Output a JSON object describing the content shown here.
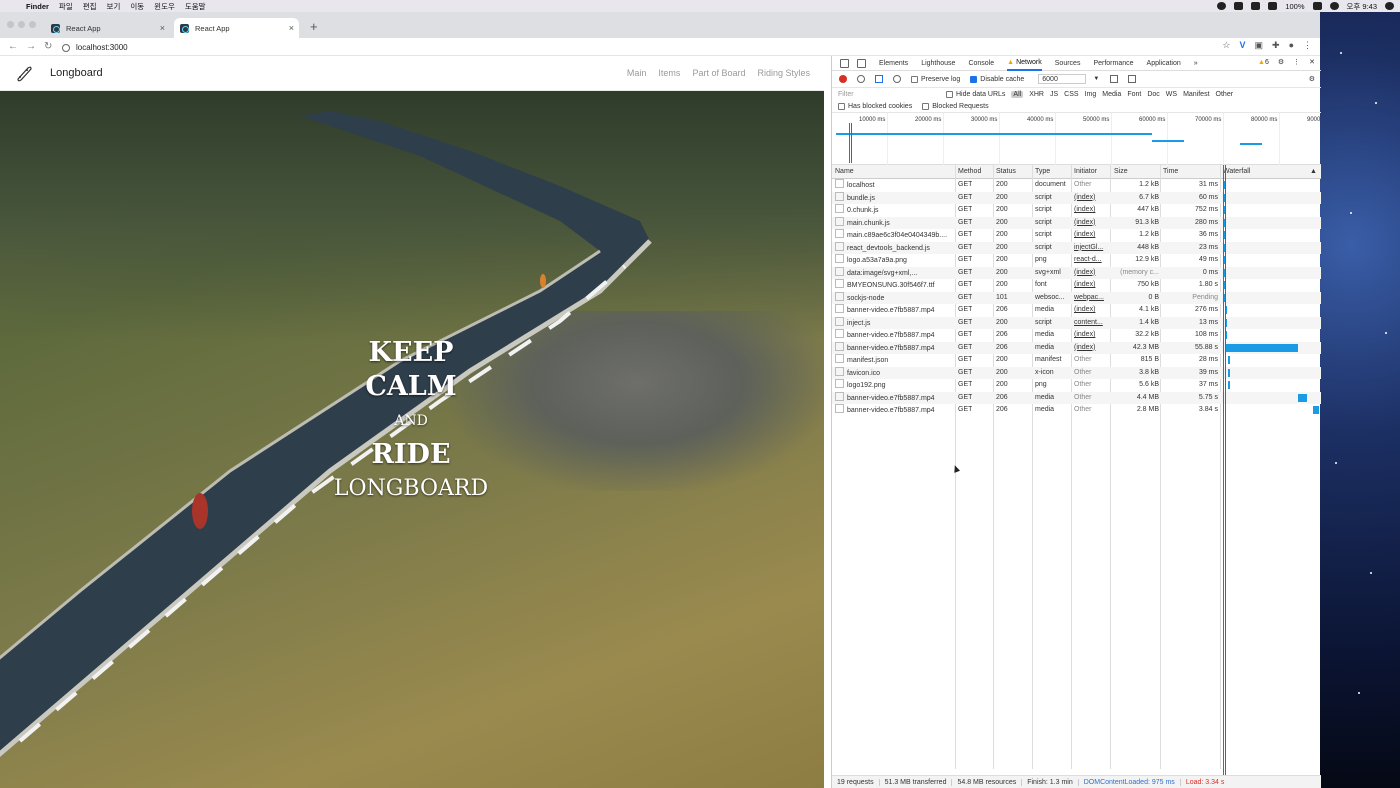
{
  "menubar": {
    "app": "Finder",
    "items": [
      "파일",
      "편집",
      "보기",
      "이동",
      "윈도우",
      "도움말"
    ],
    "battery": "100%",
    "clock": "오후 9:43"
  },
  "browser": {
    "tabs": [
      {
        "title": "React App",
        "active": false
      },
      {
        "title": "React App",
        "active": true
      }
    ],
    "url": "localhost:3000"
  },
  "app": {
    "brand": "Longboard",
    "nav": [
      "Main",
      "Items",
      "Part of Board",
      "Riding Styles"
    ],
    "hero": {
      "line1": "KEEP",
      "line2": "CALM",
      "line3": "AND",
      "line4": "RIDE",
      "line5": "LONGBOARD"
    }
  },
  "devtools": {
    "tabs": [
      "Elements",
      "Lighthouse",
      "Console",
      "Network",
      "Sources",
      "Performance",
      "Application"
    ],
    "active_tab": "Network",
    "more_tabs": "»",
    "warning_count": "6",
    "preserve_log": "Preserve log",
    "disable_cache": "Disable cache",
    "throttle": "6000",
    "filter_placeholder": "Filter",
    "hide_data_urls": "Hide data URLs",
    "filter_types": [
      "All",
      "XHR",
      "JS",
      "CSS",
      "Img",
      "Media",
      "Font",
      "Doc",
      "WS",
      "Manifest",
      "Other"
    ],
    "has_blocked_cookies": "Has blocked cookies",
    "blocked_requests": "Blocked Requests",
    "overview_ticks": [
      "10000 ms",
      "20000 ms",
      "30000 ms",
      "40000 ms",
      "50000 ms",
      "60000 ms",
      "70000 ms",
      "80000 ms",
      "9000"
    ],
    "columns": [
      "Name",
      "Method",
      "Status",
      "Type",
      "Initiator",
      "Size",
      "Time",
      "Waterfall"
    ],
    "requests": [
      {
        "name": "localhost",
        "method": "GET",
        "status": "200",
        "type": "document",
        "initiator": "Other",
        "size": "1.2 kB",
        "time": "31 ms",
        "wf_start": 0.0,
        "wf_dur": 0.01
      },
      {
        "name": "bundle.js",
        "method": "GET",
        "status": "200",
        "type": "script",
        "initiator": "(index)",
        "size": "6.7 kB",
        "time": "60 ms",
        "wf_start": 0.0,
        "wf_dur": 0.01
      },
      {
        "name": "0.chunk.js",
        "method": "GET",
        "status": "200",
        "type": "script",
        "initiator": "(index)",
        "size": "447 kB",
        "time": "752 ms",
        "wf_start": 0.0,
        "wf_dur": 0.01
      },
      {
        "name": "main.chunk.js",
        "method": "GET",
        "status": "200",
        "type": "script",
        "initiator": "(index)",
        "size": "91.3 kB",
        "time": "280 ms",
        "wf_start": 0.0,
        "wf_dur": 0.01
      },
      {
        "name": "main.c89ae6c3f04e0404349b....",
        "method": "GET",
        "status": "200",
        "type": "script",
        "initiator": "(index)",
        "size": "1.2 kB",
        "time": "36 ms",
        "wf_start": 0.0,
        "wf_dur": 0.01
      },
      {
        "name": "react_devtools_backend.js",
        "method": "GET",
        "status": "200",
        "type": "script",
        "initiator": "injectGl...",
        "size": "448 kB",
        "time": "23 ms",
        "wf_start": 0.0,
        "wf_dur": 0.01
      },
      {
        "name": "logo.a53a7a9a.png",
        "method": "GET",
        "status": "200",
        "type": "png",
        "initiator": "react-d...",
        "size": "12.9 kB",
        "time": "49 ms",
        "wf_start": 0.0,
        "wf_dur": 0.01
      },
      {
        "name": "data:image/svg+xml,...",
        "method": "GET",
        "status": "200",
        "type": "svg+xml",
        "initiator": "(index)",
        "size": "(memory c...",
        "time": "0 ms",
        "wf_start": 0.0,
        "wf_dur": 0.0
      },
      {
        "name": "BMYEONSUNG.30f546f7.ttf",
        "method": "GET",
        "status": "200",
        "type": "font",
        "initiator": "(index)",
        "size": "750 kB",
        "time": "1.80 s",
        "wf_start": 0.0,
        "wf_dur": 0.02
      },
      {
        "name": "sockjs-node",
        "method": "GET",
        "status": "101",
        "type": "websoc...",
        "initiator": "webpac...",
        "size": "0 B",
        "time": "Pending",
        "wf_start": 0.0,
        "wf_dur": 0.0
      },
      {
        "name": "banner-video.e7fb5887.mp4",
        "method": "GET",
        "status": "206",
        "type": "media",
        "initiator": "(index)",
        "size": "4.1 kB",
        "time": "276 ms",
        "wf_start": 0.01,
        "wf_dur": 0.01
      },
      {
        "name": "inject.js",
        "method": "GET",
        "status": "200",
        "type": "script",
        "initiator": "content...",
        "size": "1.4 kB",
        "time": "13 ms",
        "wf_start": 0.01,
        "wf_dur": 0.01
      },
      {
        "name": "banner-video.e7fb5887.mp4",
        "method": "GET",
        "status": "206",
        "type": "media",
        "initiator": "(index)",
        "size": "32.2 kB",
        "time": "108 ms",
        "wf_start": 0.01,
        "wf_dur": 0.01
      },
      {
        "name": "banner-video.e7fb5887.mp4",
        "method": "GET",
        "status": "206",
        "type": "media",
        "initiator": "(index)",
        "size": "42.3 MB",
        "time": "55.88 s",
        "wf_start": 0.02,
        "wf_dur": 0.76
      },
      {
        "name": "manifest.json",
        "method": "GET",
        "status": "200",
        "type": "manifest",
        "initiator": "Other",
        "size": "815 B",
        "time": "28 ms",
        "wf_start": 0.04,
        "wf_dur": 0.01
      },
      {
        "name": "favicon.ico",
        "method": "GET",
        "status": "200",
        "type": "x-icon",
        "initiator": "Other",
        "size": "3.8 kB",
        "time": "39 ms",
        "wf_start": 0.04,
        "wf_dur": 0.01
      },
      {
        "name": "logo192.png",
        "method": "GET",
        "status": "200",
        "type": "png",
        "initiator": "Other",
        "size": "5.6 kB",
        "time": "37 ms",
        "wf_start": 0.04,
        "wf_dur": 0.01
      },
      {
        "name": "banner-video.e7fb5887.mp4",
        "method": "GET",
        "status": "206",
        "type": "media",
        "initiator": "Other",
        "size": "4.4 MB",
        "time": "5.75 s",
        "wf_start": 0.78,
        "wf_dur": 0.09
      },
      {
        "name": "banner-video.e7fb5887.mp4",
        "method": "GET",
        "status": "206",
        "type": "media",
        "initiator": "Other",
        "size": "2.8 MB",
        "time": "3.84 s",
        "wf_start": 0.94,
        "wf_dur": 0.06
      }
    ],
    "summary": {
      "requests": "19 requests",
      "transferred": "51.3 MB transferred",
      "resources": "54.8 MB resources",
      "finish": "Finish: 1.3 min",
      "dcl": "DOMContentLoaded: 975 ms",
      "load": "Load: 3.34 s"
    },
    "colors": {
      "accent": "#1a73e8",
      "bar": "#1a9be6",
      "record": "#d93025"
    }
  }
}
